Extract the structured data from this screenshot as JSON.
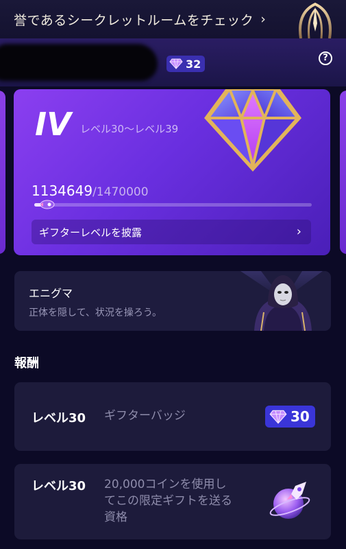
{
  "banner": {
    "text": "誉であるシークレットルームをチェック",
    "chevron": "›"
  },
  "header": {
    "gem_count": "32",
    "help_symbol": "?"
  },
  "level_card": {
    "roman_level": "IV",
    "level_range": "レベル30〜レベル39",
    "current_points": "1134649",
    "total_points": "/1470000",
    "progress": 0.03,
    "reveal_label": "ギフターレベルを披露",
    "reveal_arrow": "›"
  },
  "enigma": {
    "title": "エニグマ",
    "description": "正体を隠して、状況を操ろう。"
  },
  "rewards": {
    "heading": "報酬",
    "items": [
      {
        "level": "レベル30",
        "description": "ギフターバッジ",
        "badge_value": "30"
      },
      {
        "level": "レベル30",
        "description_lines": [
          "20,000コインを使用し",
          "てこの限定ギフトを送る",
          "資格"
        ]
      }
    ]
  },
  "colors": {
    "background": "#0c0a26",
    "card_purple": "#7a35e8",
    "badge_blue": "#3a35d8",
    "gold": "#e2b45a"
  },
  "icons": [
    "crest-icon",
    "gem-icon",
    "help-icon",
    "chevron-right-icon",
    "rocket-icon",
    "hooded-figure-icon"
  ]
}
